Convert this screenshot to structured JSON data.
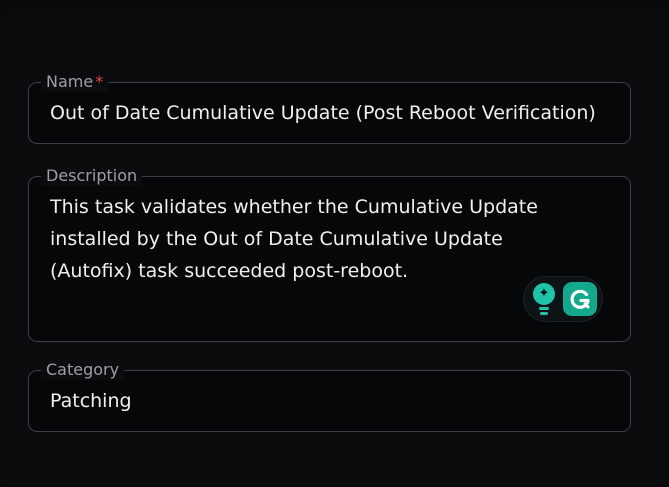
{
  "form": {
    "name": {
      "label": "Name",
      "required_marker": "*",
      "value": "Out of Date Cumulative Update (Post Reboot Verification)"
    },
    "description": {
      "label": "Description",
      "value": "This task validates whether the Cumulative Update installed by the Out of Date Cumulative Update (Autofix) task succeeded post-reboot."
    },
    "category": {
      "label": "Category",
      "value": "Patching"
    }
  },
  "grammarly": {
    "icons": [
      "grammarly-suggestion-bulb-icon",
      "grammarly-logo-icon"
    ],
    "accent": "#1fc3a8"
  },
  "colors": {
    "background": "#0a0c0e",
    "field_border": "#3b4147",
    "label": "#9aa0a6",
    "text": "#eef0f2",
    "required": "#e5484d"
  }
}
